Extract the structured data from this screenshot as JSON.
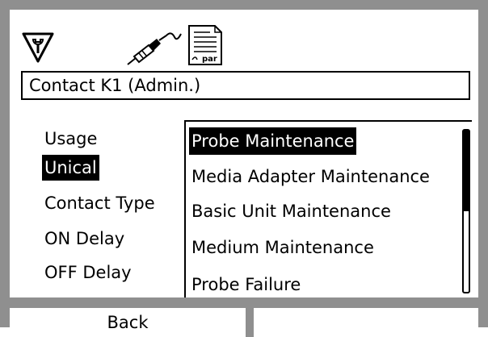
{
  "header": {
    "status_icons": [
      "wrench-warning-icon",
      "probe-icon",
      "parameter-document-icon"
    ],
    "par_label": "par"
  },
  "title": "Contact K1 (Admin.)",
  "menu": {
    "items": [
      "Usage",
      "Unical",
      "Contact Type",
      "ON Delay",
      "OFF Delay"
    ],
    "selected": "Unical"
  },
  "options": {
    "items": [
      "Probe Maintenance",
      "Media Adapter Maintenance",
      "Basic Unit Maintenance",
      "Medium Maintenance",
      "Probe Failure"
    ],
    "selected": "Probe Maintenance"
  },
  "softkeys": {
    "left": "Back",
    "right": ""
  },
  "colors": {
    "bezel": "#8f8f8f",
    "highlight_bg": "#000000",
    "highlight_fg": "#ffffff"
  }
}
